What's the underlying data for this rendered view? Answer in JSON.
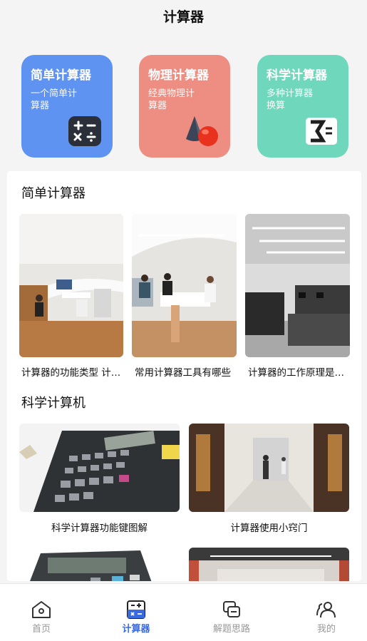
{
  "header": {
    "title": "计算器"
  },
  "cards": [
    {
      "title": "简单计算器",
      "desc": "一个简单计算器",
      "color": "#5f93f2",
      "icon": "calculator-icon"
    },
    {
      "title": "物理计算器",
      "desc": "经典物理计算器",
      "color": "#ee8d82",
      "icon": "cone-sphere-icon"
    },
    {
      "title": "科学计算器",
      "desc": "多种计算器换算",
      "color": "#6fd8bc",
      "icon": "sigma-icon"
    }
  ],
  "simple": {
    "title": "简单计算器",
    "items": [
      {
        "caption": "计算器的功能类型 计算器的种类"
      },
      {
        "caption": "常用计算器工具有哪些"
      },
      {
        "caption": "计算器的工作原理是什么"
      }
    ]
  },
  "science": {
    "title": "科学计算机",
    "items": [
      {
        "caption": "科学计算器功能键图解"
      },
      {
        "caption": "计算器使用小窍门"
      }
    ]
  },
  "tabs": [
    {
      "label": "首页",
      "icon": "home-icon",
      "active": false
    },
    {
      "label": "计算器",
      "icon": "calculator-tab-icon",
      "active": true
    },
    {
      "label": "解题思路",
      "icon": "chat-icon",
      "active": false
    },
    {
      "label": "我的",
      "icon": "users-icon",
      "active": false
    }
  ],
  "colors": {
    "accent": "#3a6ae0",
    "inactive": "#999999"
  }
}
